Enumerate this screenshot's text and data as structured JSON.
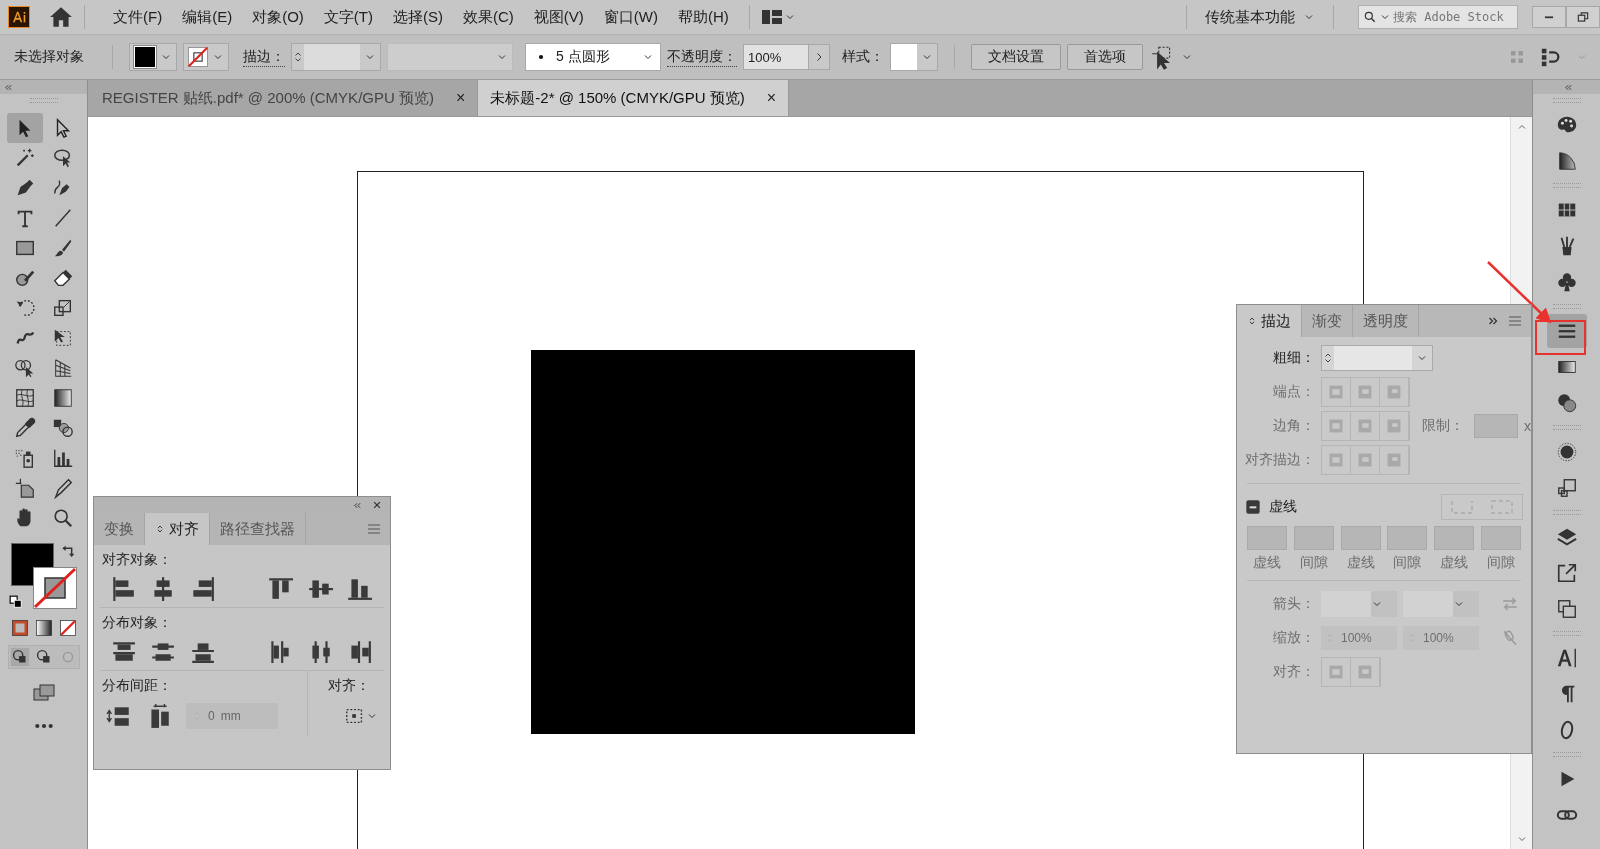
{
  "menu_bar": {
    "items": [
      "文件(F)",
      "编辑(E)",
      "对象(O)",
      "文字(T)",
      "选择(S)",
      "效果(C)",
      "视图(V)",
      "窗口(W)",
      "帮助(H)"
    ],
    "workspace": "传统基本功能",
    "search": {
      "placeholder": "搜索 Adobe Stock"
    }
  },
  "control_bar": {
    "selection": "未选择对象",
    "stroke_label": "描边：",
    "brush": "5 点圆形",
    "opacity_label": "不透明度：",
    "opacity": "100%",
    "style_label": "样式：",
    "buttons": [
      "文档设置",
      "首选项"
    ]
  },
  "document_tabs": [
    {
      "title": "REGISTER 贴纸.pdf* @ 200% (CMYK/GPU 预览)",
      "close": "×",
      "selected": false
    },
    {
      "title": "未标题-2* @ 150% (CMYK/GPU 预览)",
      "close": "×",
      "selected": true
    }
  ],
  "tools": [
    {
      "kind": "selection",
      "selected": true
    },
    {
      "kind": "direct-selection",
      "selected": false
    },
    {
      "kind": "magic-wand",
      "selected": false
    },
    {
      "kind": "lasso",
      "selected": false
    },
    {
      "kind": "pen",
      "selected": false
    },
    {
      "kind": "curvature",
      "selected": false
    },
    {
      "kind": "type",
      "selected": false
    },
    {
      "kind": "line",
      "selected": false
    },
    {
      "kind": "rectangle",
      "selected": false
    },
    {
      "kind": "paintbrush",
      "selected": false
    },
    {
      "kind": "shaper",
      "selected": false
    },
    {
      "kind": "eraser",
      "selected": false
    },
    {
      "kind": "rotate",
      "selected": false
    },
    {
      "kind": "scale",
      "selected": false
    },
    {
      "kind": "warp",
      "selected": false
    },
    {
      "kind": "free-transform",
      "selected": false
    },
    {
      "kind": "shape-builder",
      "selected": false
    },
    {
      "kind": "perspective",
      "selected": false
    },
    {
      "kind": "mesh",
      "selected": false
    },
    {
      "kind": "gradient",
      "selected": false
    },
    {
      "kind": "eyedropper",
      "selected": false
    },
    {
      "kind": "blend",
      "selected": false
    },
    {
      "kind": "symbol-sprayer",
      "selected": false
    },
    {
      "kind": "graph",
      "selected": false
    },
    {
      "kind": "artboard",
      "selected": false
    },
    {
      "kind": "slice",
      "selected": false
    },
    {
      "kind": "hand",
      "selected": false
    },
    {
      "kind": "zoom",
      "selected": false
    }
  ],
  "align_panel": {
    "tabs": [
      {
        "label": "变换",
        "selected": false
      },
      {
        "label": "对齐",
        "selected": true
      },
      {
        "label": "路径查找器",
        "selected": false
      }
    ],
    "align_label": "对齐对象：",
    "distribute_label": "分布对象：",
    "spacing_label": "分布间距：",
    "spacing_value": "0",
    "spacing_unit": "mm",
    "align_to_label": "对齐："
  },
  "stroke_panel": {
    "tabs": [
      {
        "label": "描边",
        "selected": true
      },
      {
        "label": "渐变",
        "selected": false
      },
      {
        "label": "透明度",
        "selected": false
      }
    ],
    "weight_label": "粗细：",
    "cap_label": "端点：",
    "corner_label": "边角：",
    "limit_label": "限制：",
    "limit_unit": "x",
    "align_label": "对齐描边：",
    "dashed_label": "虚线",
    "dash_fields": [
      "虚线",
      "间隙",
      "虚线",
      "间隙",
      "虚线",
      "间隙"
    ],
    "arrowhead_label": "箭头：",
    "scale_label": "缩放：",
    "scale_values": [
      "100%",
      "100%"
    ],
    "arrow_align_label": "对齐："
  },
  "dock": {
    "groups": [
      [
        {
          "kind": "palette",
          "selected": false
        },
        {
          "kind": "color-guide",
          "selected": false
        }
      ],
      [
        {
          "kind": "swatches",
          "selected": false
        },
        {
          "kind": "brushes",
          "selected": false
        },
        {
          "kind": "symbols",
          "selected": false
        }
      ],
      [
        {
          "kind": "stroke",
          "selected": true
        },
        {
          "kind": "gradient",
          "selected": false
        },
        {
          "kind": "transparency",
          "selected": false
        }
      ],
      [
        {
          "kind": "appearance",
          "selected": false
        },
        {
          "kind": "graphic-styles",
          "selected": false
        }
      ],
      [
        {
          "kind": "layers",
          "selected": false
        },
        {
          "kind": "export",
          "selected": false
        },
        {
          "kind": "artboards",
          "selected": false
        }
      ],
      [
        {
          "kind": "character",
          "selected": false
        },
        {
          "kind": "paragraph",
          "selected": false
        },
        {
          "kind": "opentype",
          "selected": false
        }
      ],
      [
        {
          "kind": "actions",
          "selected": false
        },
        {
          "kind": "links",
          "selected": false
        }
      ]
    ]
  }
}
